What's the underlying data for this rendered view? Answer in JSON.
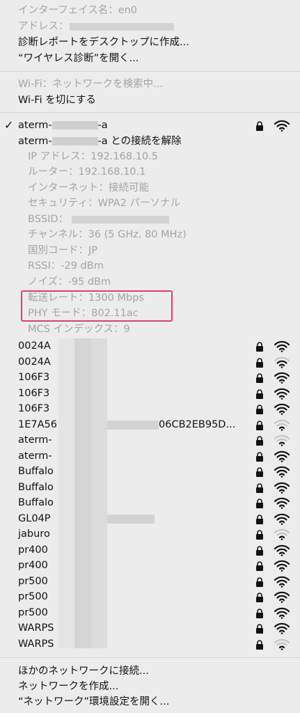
{
  "header": {
    "interface": "インターフェイス名：en0",
    "address": "アドレス：",
    "create_report": "診断レポートをデスクトップに作成...",
    "open_diagnostics": "“ワイヤレス診断”を開く..."
  },
  "wifi_section": {
    "status": "Wi-Fi：ネットワークを検索中...",
    "turn_off": "Wi-Fi を切にする"
  },
  "connected": {
    "name": "aterm-",
    "name_suffix": "-a",
    "disconnect_prefix": "aterm-",
    "disconnect_suffix": "-a との接続を解除",
    "details": [
      "IP アドレス：192.168.10.5",
      "ルーター：192.168.10.1",
      "インターネット：接続可能",
      "セキュリティ：WPA2 パーソナル",
      "BSSID：",
      "チャンネル：36 (5 GHz, 80 MHz)",
      "国別コード：JP",
      "RSSI：-29 dBm",
      "ノイズ：-95 dBm",
      "転送レート：1300 Mbps",
      "PHY モード：802.11ac",
      "MCS インデックス：9"
    ]
  },
  "networks": [
    {
      "name": "0024A",
      "strength": 3
    },
    {
      "name": "0024A",
      "strength": 2
    },
    {
      "name": "106F3",
      "strength": 3
    },
    {
      "name": "106F3",
      "strength": 3
    },
    {
      "name": "106F3",
      "strength": 3
    },
    {
      "name": "1E7A56",
      "suffix": "06CB2EB95D...",
      "strength": 1
    },
    {
      "name": "aterm-",
      "strength": 1
    },
    {
      "name": "aterm-",
      "strength": 3
    },
    {
      "name": "Buffalo",
      "strength": 3
    },
    {
      "name": "Buffalo",
      "strength": 3
    },
    {
      "name": "Buffalo",
      "strength": 3
    },
    {
      "name": "GL04P",
      "strength": 3
    },
    {
      "name": "jaburo",
      "strength": 1
    },
    {
      "name": "pr400",
      "strength": 3
    },
    {
      "name": "pr400",
      "strength": 3
    },
    {
      "name": "pr500",
      "strength": 3
    },
    {
      "name": "pr500",
      "strength": 3
    },
    {
      "name": "pr500",
      "strength": 3
    },
    {
      "name": "WARPS",
      "strength": 3
    },
    {
      "name": "WARPS",
      "strength": 1
    }
  ],
  "footer": {
    "other_network": "ほかのネットワークに接続...",
    "create_network": "ネットワークを作成...",
    "open_prefs": "“ネットワーク”環境設定を開く..."
  },
  "colors": {
    "background": "#ececec",
    "text": "#111111",
    "disabled": "#a4a4a4",
    "highlight": "#e6377a"
  }
}
